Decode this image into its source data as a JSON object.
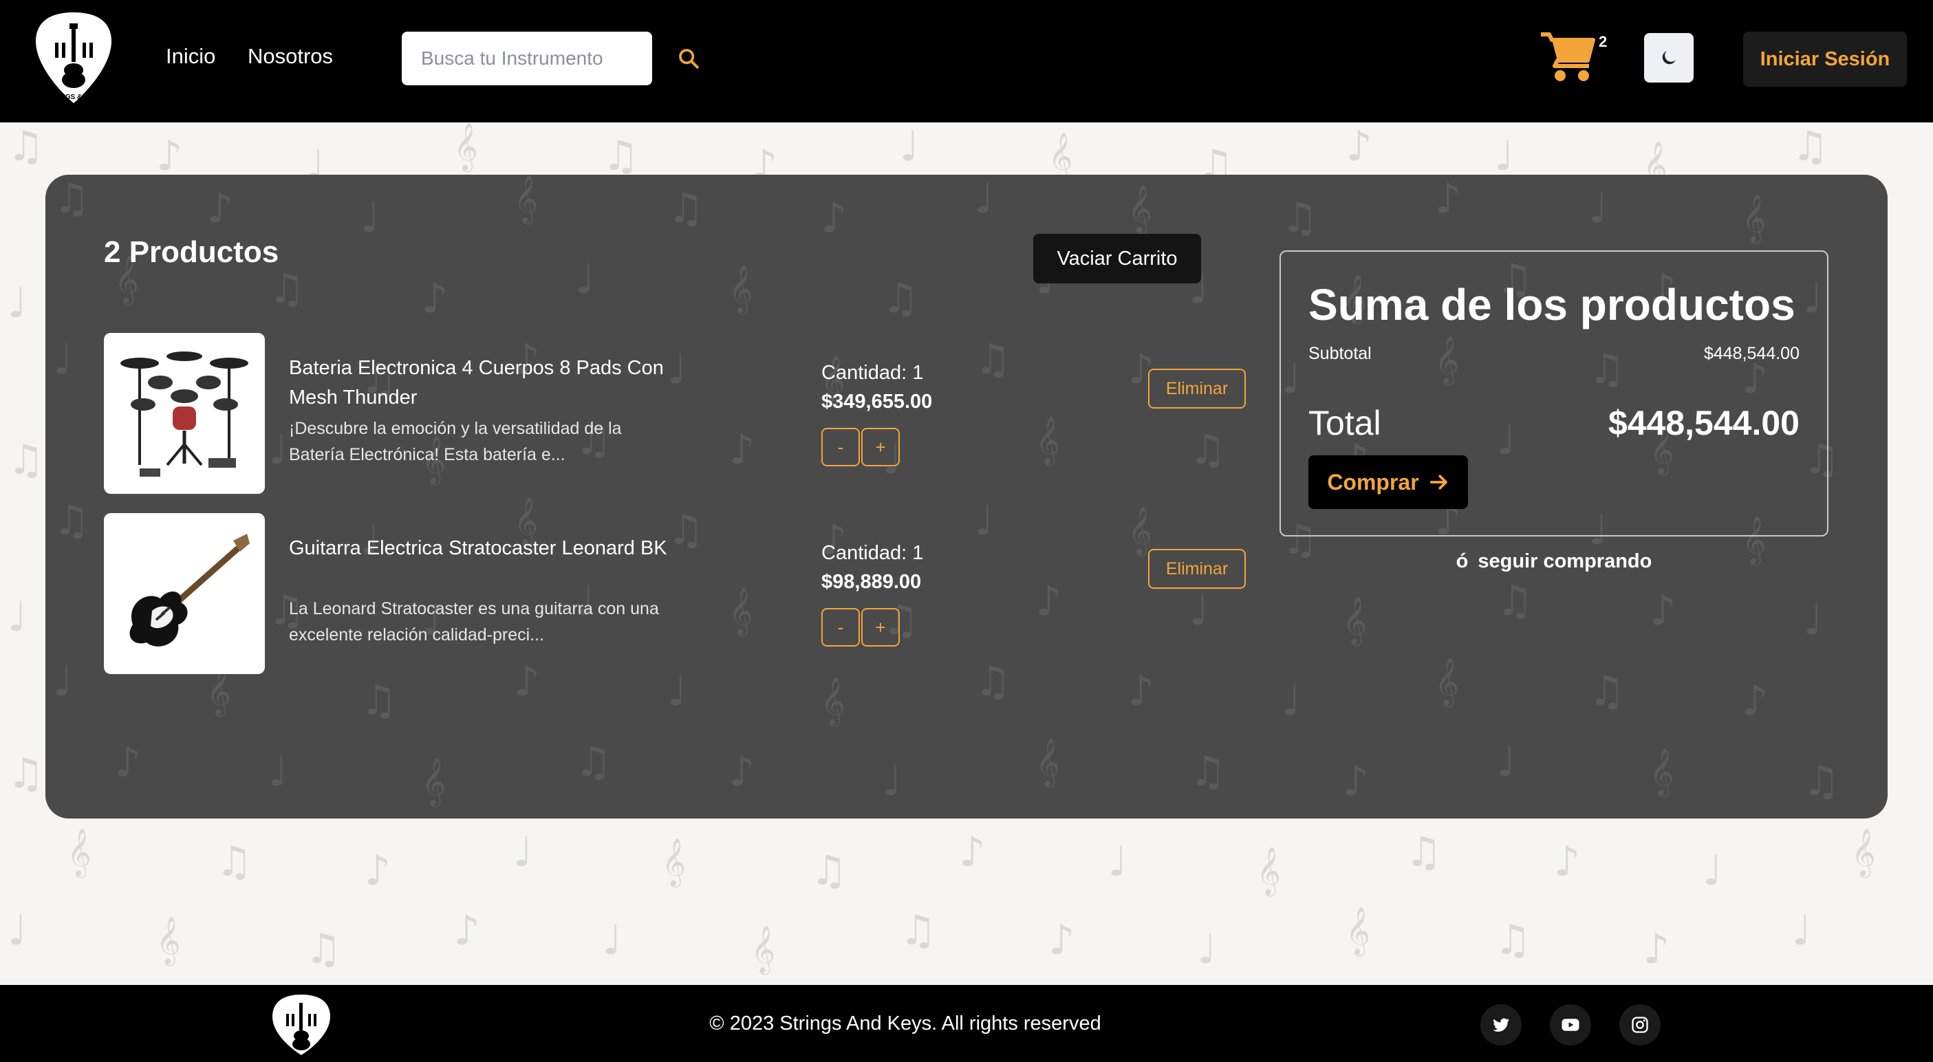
{
  "header": {
    "logo_text": "STRINGS & KEYS",
    "nav": [
      "Inicio",
      "Nosotros"
    ],
    "search_placeholder": "Busca tu Instrumento",
    "cart_count": "2",
    "login_label": "Iniciar Sesión"
  },
  "cart": {
    "products_count": "2 Productos",
    "empty_label": "Vaciar Carrito",
    "items": [
      {
        "name": "Bateria Electronica 4 Cuerpos 8 Pads Con Mesh Thunder",
        "description": "¡Descubre la emoción y la versatilidad de la Batería Electrónica! Esta batería e...",
        "quantity": "Cantidad: 1",
        "price": "$349,655.00",
        "minus": "-",
        "plus": "+",
        "remove": "Eliminar"
      },
      {
        "name": "Guitarra Electrica Stratocaster Leonard BK",
        "description": "La Leonard Stratocaster es una guitarra con una excelente relación calidad-preci...",
        "quantity": "Cantidad: 1",
        "price": "$98,889.00",
        "minus": "-",
        "plus": "+",
        "remove": "Eliminar"
      }
    ]
  },
  "summary": {
    "title": "Suma de los productos",
    "subtotal_label": "Subtotal",
    "subtotal_value": "$448,544.00",
    "total_label": "Total",
    "total_value": "$448,544.00",
    "buy_label": "Comprar",
    "or": "ó",
    "continue_label": "seguir comprando"
  },
  "footer": {
    "copyright": "© 2023 Strings And Keys. All rights reserved"
  },
  "colors": {
    "accent": "#f3a53a",
    "panel": "#4a4a4a",
    "header": "#000000"
  }
}
